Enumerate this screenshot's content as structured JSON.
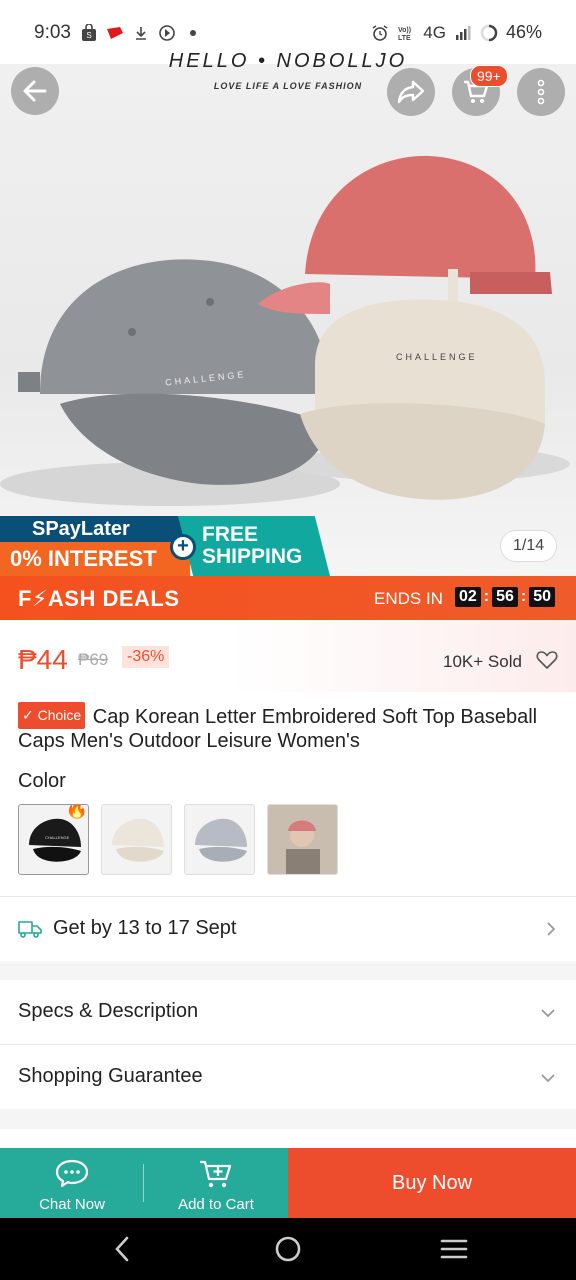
{
  "status_bar": {
    "time": "9:03",
    "network": "4G",
    "battery": "46%"
  },
  "header": {
    "brand_title": "HELLO • NOBOLLJO",
    "brand_subtitle": "LOVE LIFE A LOVE FASHION",
    "cart_badge": "99+"
  },
  "hero": {
    "cap_text_left": "CHALLENGE",
    "cap_text_right": "CHALLENGE",
    "promo_spaylater": "SPayLater",
    "promo_interest": "0% INTEREST",
    "promo_free_shipping_line1": "FREE",
    "promo_free_shipping_line2": "SHIPPING",
    "image_counter": "1/14"
  },
  "flash_deals": {
    "title": "F⚡ASH DEALS",
    "ends_in_label": "ENDS IN",
    "timer_hours": "02",
    "timer_minutes": "56",
    "timer_seconds": "50"
  },
  "product": {
    "price": "₱44",
    "original_price": "₱69",
    "discount": "-36%",
    "sold": "10K+ Sold",
    "choice_badge": "✓ Choice",
    "title": "Cap Korean Letter Embroidered Soft Top Baseball Caps Men's Outdoor Leisure Women's"
  },
  "variants": {
    "label": "Color",
    "options": [
      "black",
      "beige",
      "grey",
      "photo"
    ]
  },
  "delivery": {
    "text": "Get by 13 to 17 Sept"
  },
  "sections": {
    "specs": "Specs & Description",
    "guarantee": "Shopping Guarantee"
  },
  "action_bar": {
    "chat_label": "Chat Now",
    "cart_label": "Add to Cart",
    "buy_label": "Buy Now"
  },
  "colors": {
    "accent": "#ee4d2d",
    "teal": "#26aa99",
    "flash_orange": "#f4511e"
  }
}
